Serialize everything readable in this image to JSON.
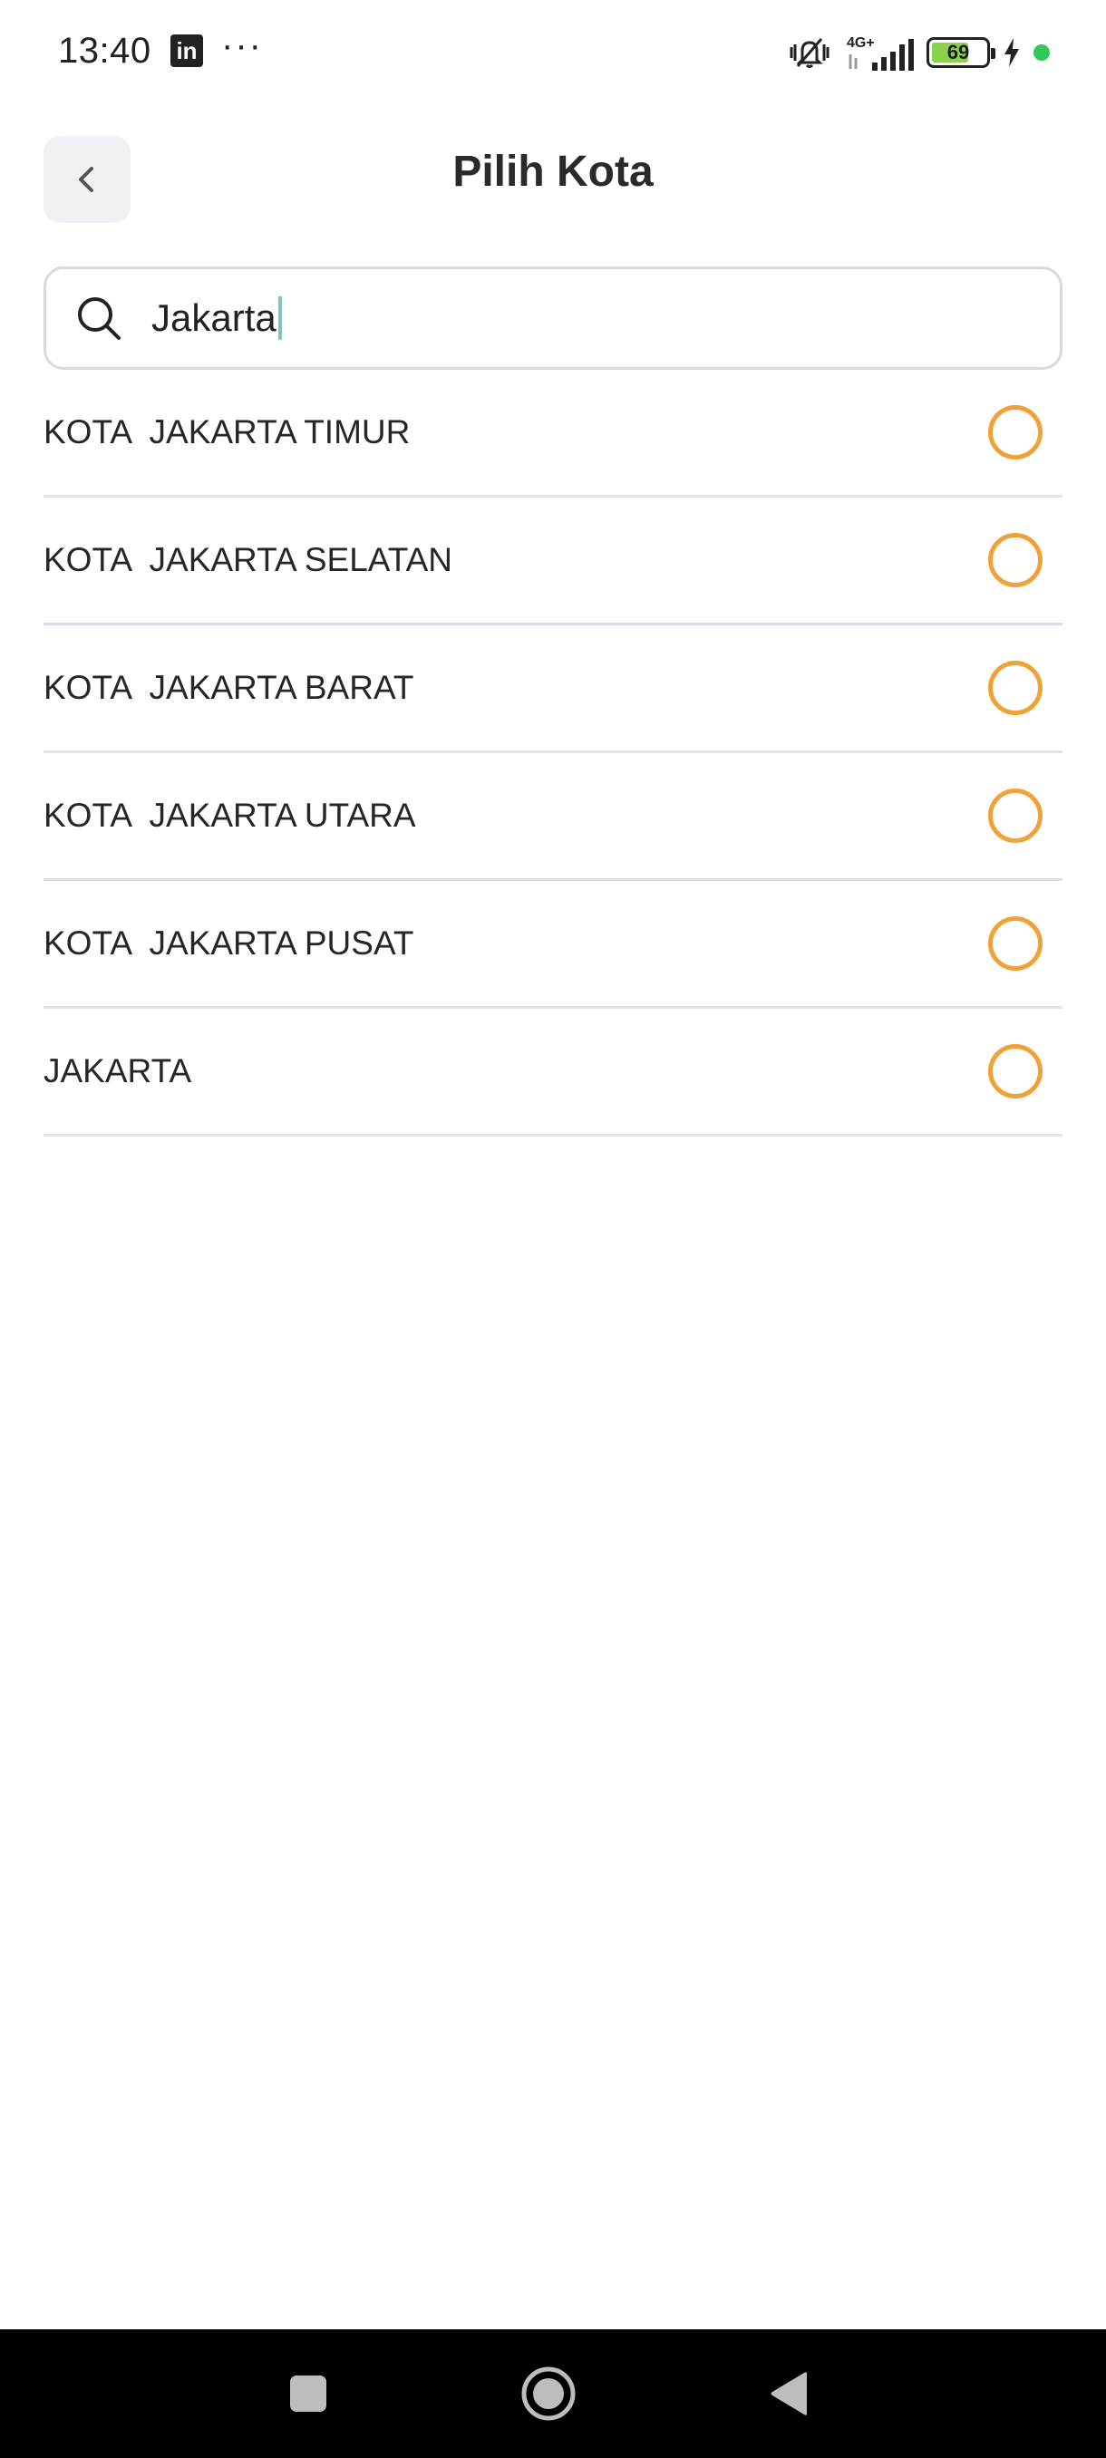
{
  "status_bar": {
    "time": "13:40",
    "linkedin_label": "in",
    "more_dots": "···",
    "network": "4G+",
    "battery_level": "69",
    "icons": [
      "linkedin-icon",
      "more-icon",
      "vibrate-mute-icon",
      "signal-icon",
      "battery-icon",
      "charging-icon",
      "privacy-dot-icon"
    ]
  },
  "header": {
    "title": "Pilih Kota",
    "back_icon": "chevron-left-icon"
  },
  "search": {
    "value": "Jakarta",
    "icon": "search-icon"
  },
  "cities": [
    {
      "label": "KOTA  JAKARTA TIMUR",
      "selected": false
    },
    {
      "label": "KOTA  JAKARTA SELATAN",
      "selected": false
    },
    {
      "label": "KOTA  JAKARTA BARAT",
      "selected": false
    },
    {
      "label": "KOTA  JAKARTA UTARA",
      "selected": false
    },
    {
      "label": "KOTA  JAKARTA PUSAT",
      "selected": false
    },
    {
      "label": "JAKARTA",
      "selected": false
    }
  ],
  "colors": {
    "radio_border": "#f0a23a",
    "divider": "#e3e3e8",
    "back_button_bg": "#f0f1f5",
    "caret": "#7fc6c2",
    "nav_bar": "#000000"
  },
  "nav_bar": {
    "icons": [
      "recent-apps-icon",
      "home-icon",
      "back-icon"
    ]
  }
}
